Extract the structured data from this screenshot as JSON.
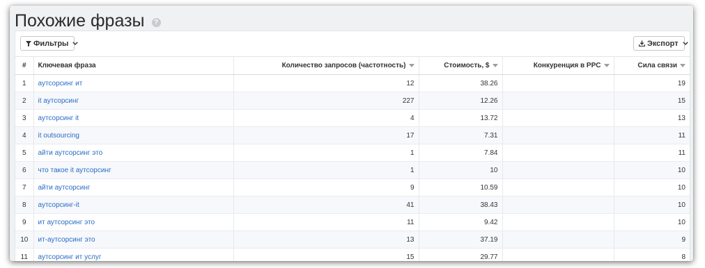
{
  "header": {
    "title": "Похожие фразы",
    "help_icon": "question-circle-icon"
  },
  "toolbar": {
    "filter_label": "Фильтры",
    "filter_icon": "filter-icon",
    "export_label": "Экспорт",
    "export_icon": "download-icon"
  },
  "table": {
    "columns": {
      "num": "#",
      "phrase": "Ключевая фраза",
      "queries": "Количество запросов (частотность)",
      "cost": "Стоимость, $",
      "ppc": "Конкуренция в PPC",
      "strength": "Сила связи"
    },
    "rows": [
      {
        "num": "1",
        "phrase": "аутсорсинг ит",
        "queries": "12",
        "cost": "38.26",
        "ppc": "",
        "strength": "19"
      },
      {
        "num": "2",
        "phrase": "it аутсорсинг",
        "queries": "227",
        "cost": "12.26",
        "ppc": "",
        "strength": "15"
      },
      {
        "num": "3",
        "phrase": "аутсорсинг it",
        "queries": "4",
        "cost": "13.72",
        "ppc": "",
        "strength": "13"
      },
      {
        "num": "4",
        "phrase": "it outsourcing",
        "queries": "17",
        "cost": "7.31",
        "ppc": "",
        "strength": "11"
      },
      {
        "num": "5",
        "phrase": "айти аутсорсинг это",
        "queries": "1",
        "cost": "7.84",
        "ppc": "",
        "strength": "11"
      },
      {
        "num": "6",
        "phrase": "что такое it аутсорсинг",
        "queries": "1",
        "cost": "10",
        "ppc": "",
        "strength": "10"
      },
      {
        "num": "7",
        "phrase": "айти аутсорсинг",
        "queries": "9",
        "cost": "10.59",
        "ppc": "",
        "strength": "10"
      },
      {
        "num": "8",
        "phrase": "аутсорсинг-it",
        "queries": "41",
        "cost": "38.43",
        "ppc": "",
        "strength": "10"
      },
      {
        "num": "9",
        "phrase": "ит аутсорсинг это",
        "queries": "11",
        "cost": "9.42",
        "ppc": "",
        "strength": "10"
      },
      {
        "num": "10",
        "phrase": "ит-аутсорсинг это",
        "queries": "13",
        "cost": "37.19",
        "ppc": "",
        "strength": "9"
      },
      {
        "num": "11",
        "phrase": "аутсорсинг ит услуг",
        "queries": "15",
        "cost": "29.77",
        "ppc": "",
        "strength": "8"
      }
    ]
  },
  "colors": {
    "link": "#2a6cc4",
    "row_alt": "#f6f8fb",
    "frame_bg": "#f0f1f3"
  }
}
